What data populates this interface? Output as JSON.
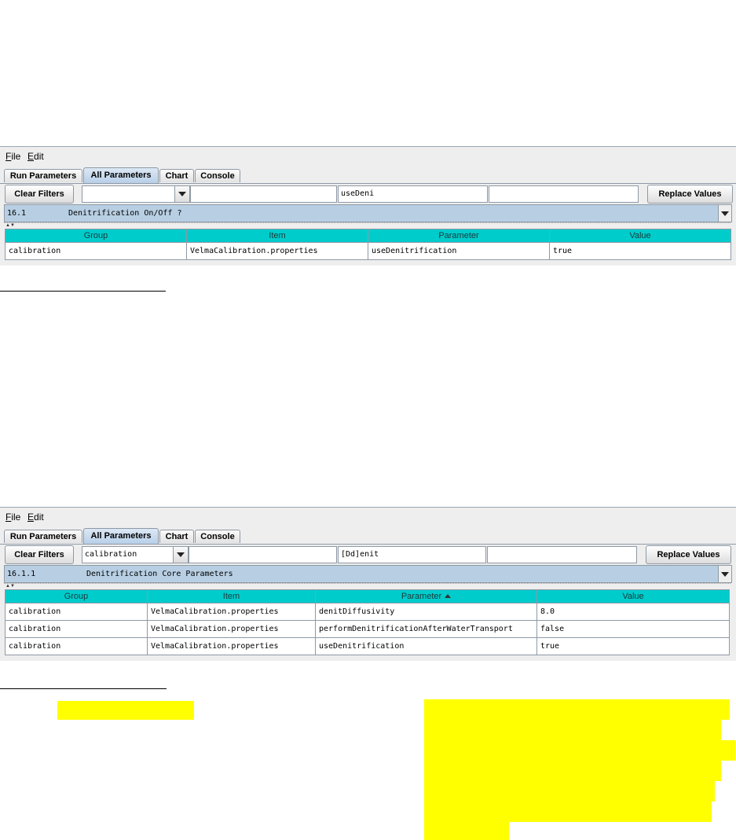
{
  "panel1": {
    "menu": [
      {
        "label": "File",
        "mnemonic": "F",
        "rest": "ile"
      },
      {
        "label": "Edit",
        "mnemonic": "E",
        "rest": "dit"
      }
    ],
    "tabs": [
      "Run Parameters",
      "All Parameters",
      "Chart",
      "Console"
    ],
    "active_tab": "All Parameters",
    "clear_filters_label": "Clear Filters",
    "group_filter_value": "",
    "item_filter_value": "",
    "parameter_filter_value": "useDeni",
    "value_filter_value": "",
    "replace_values_label": "Replace Values",
    "section_number": "16.1",
    "section_title": "Denitrification On/Off ?",
    "columns": [
      "Group",
      "Item",
      "Parameter",
      "Value"
    ],
    "rows": [
      {
        "group": "calibration",
        "item": "VelmaCalibration.properties",
        "parameter": "useDenitrification",
        "value": "true"
      }
    ]
  },
  "panel2": {
    "menu": [
      {
        "label": "File",
        "mnemonic": "F",
        "rest": "ile"
      },
      {
        "label": "Edit",
        "mnemonic": "E",
        "rest": "dit"
      }
    ],
    "tabs": [
      "Run Parameters",
      "All Parameters",
      "Chart",
      "Console"
    ],
    "active_tab": "All Parameters",
    "clear_filters_label": "Clear Filters",
    "group_filter_value": "calibration",
    "item_filter_value": "",
    "parameter_filter_value": "[Dd]enit",
    "value_filter_value": "",
    "replace_values_label": "Replace Values",
    "section_number": "16.1.1",
    "section_title": "Denitrification Core Parameters",
    "columns": [
      "Group",
      "Item",
      "Parameter",
      "Value"
    ],
    "sorted_column": "Parameter",
    "rows": [
      {
        "group": "calibration",
        "item": "VelmaCalibration.properties",
        "parameter": "denitDiffusivity",
        "value": "8.0"
      },
      {
        "group": "calibration",
        "item": "VelmaCalibration.properties",
        "parameter": "performDenitrificationAfterWaterTransport",
        "value": "false"
      },
      {
        "group": "calibration",
        "item": "VelmaCalibration.properties",
        "parameter": "useDenitrification",
        "value": "true"
      }
    ]
  },
  "colors": {
    "header_bg": "#00cccc",
    "section_bg": "#b8cfe3",
    "highlight": "#ffff00",
    "panel_bg": "#eeeeee"
  }
}
